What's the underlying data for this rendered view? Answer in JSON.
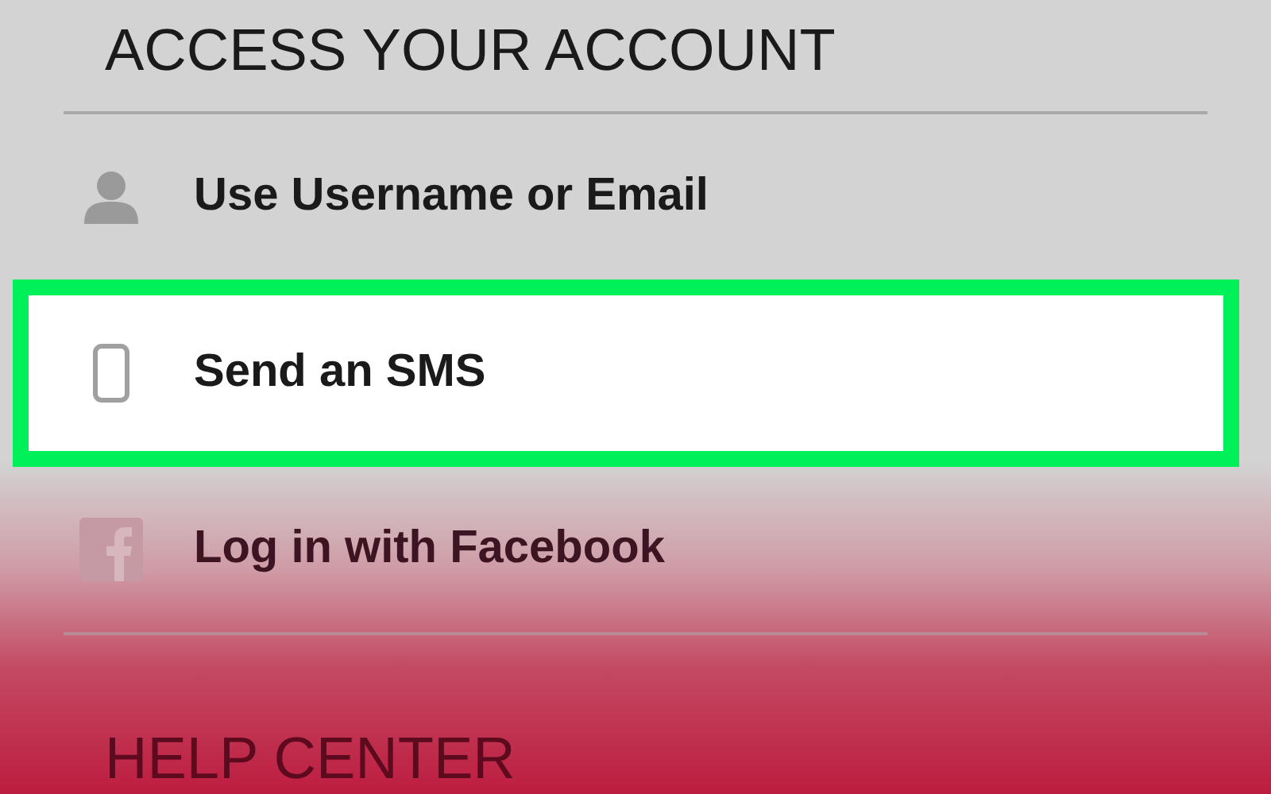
{
  "header": {
    "title": "ACCESS YOUR ACCOUNT"
  },
  "options": [
    {
      "kind": "person",
      "label": "Use Username or Email",
      "selected": false
    },
    {
      "kind": "phone",
      "label": "Send an SMS",
      "selected": true
    },
    {
      "kind": "facebook",
      "label": "Log in with Facebook",
      "selected": false
    }
  ],
  "section": {
    "title": "HELP CENTER"
  }
}
